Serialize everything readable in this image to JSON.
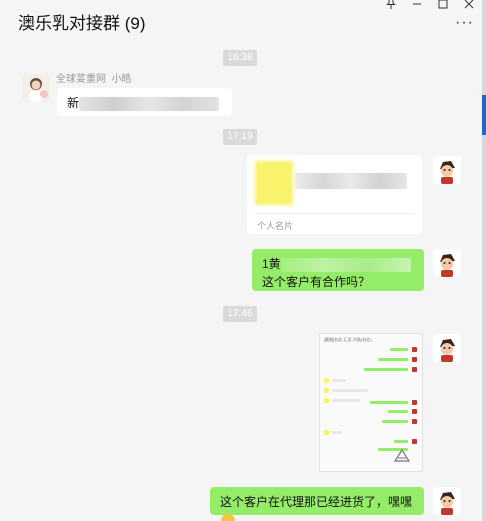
{
  "window": {
    "title": "澳乐乳对接群 (9)",
    "controls": {
      "pin": "pin-icon",
      "minimize": "minimize-icon",
      "maximize": "maximize-icon",
      "close": "close-icon"
    },
    "more_label": "···"
  },
  "messages": {
    "time1": "16:38",
    "sender_group": "全球荽重网",
    "sender_name": "小皓",
    "msg1_prefix": "新",
    "time2": "17:19",
    "card_label": "个人名片",
    "msg2_prefix": "1黄",
    "msg2_line2": "这个客户有合作吗？",
    "time3": "17:46",
    "thumb_title": "[截图]台北-汇总-大陆(台北)",
    "msg3": "这个客户在代理那已经进货了，嘿嘿"
  },
  "colors": {
    "bubble_green": "#95ec69",
    "bubble_white": "#ffffff",
    "background": "#f5f5f5",
    "time_pill": "#dadada"
  }
}
